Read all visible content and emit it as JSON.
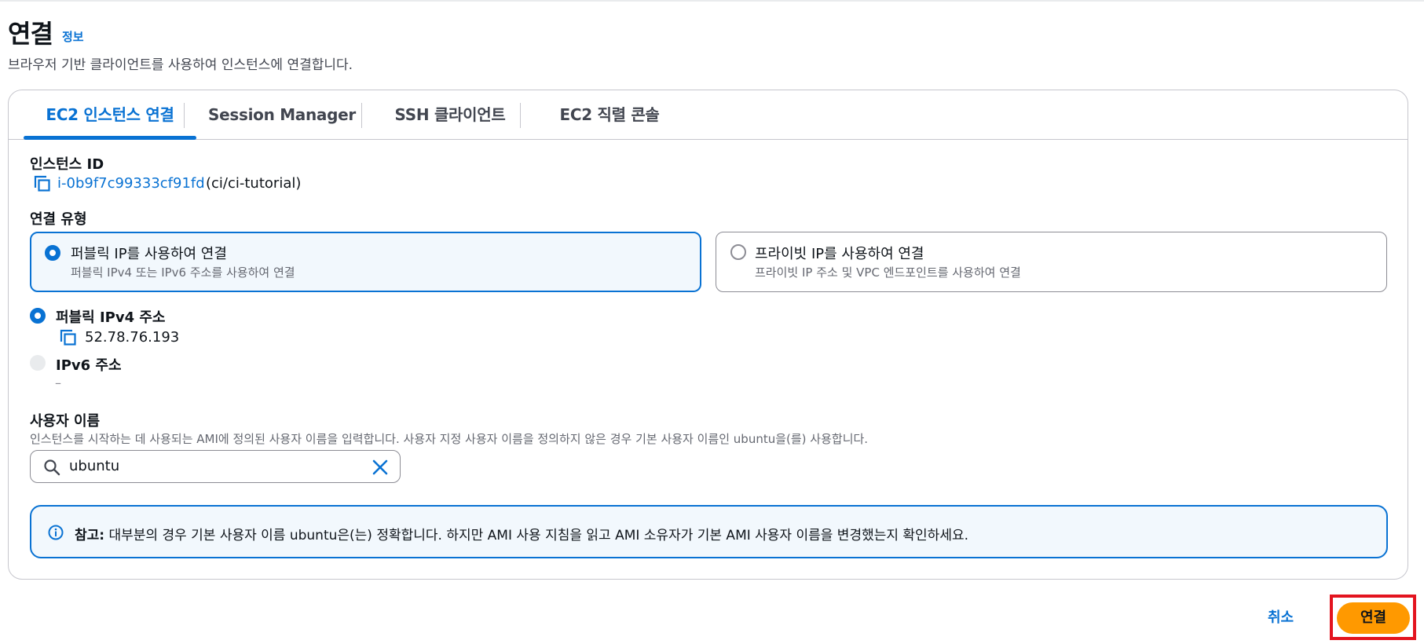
{
  "header": {
    "title": "연결",
    "info_link": "정보",
    "subtitle": "브라우저 기반 클라이언트를 사용하여 인스턴스에 연결합니다."
  },
  "tabs": [
    {
      "label": "EC2 인스턴스 연결",
      "active": true
    },
    {
      "label": "Session Manager",
      "active": false
    },
    {
      "label": "SSH 클라이언트",
      "active": false
    },
    {
      "label": "EC2 직렬 콘솔",
      "active": false
    }
  ],
  "instance": {
    "label": "인스턴스 ID",
    "id": "i-0b9f7c99333cf91fd",
    "name": "(ci/ci-tutorial)"
  },
  "connection_type": {
    "label": "연결 유형",
    "options": [
      {
        "title": "퍼블릭 IP를 사용하여 연결",
        "description": "퍼블릭 IPv4 또는 IPv6 주소를 사용하여 연결",
        "selected": true
      },
      {
        "title": "프라이빗 IP를 사용하여 연결",
        "description": "프라이빗 IP 주소 및 VPC 엔드포인트를 사용하여 연결",
        "selected": false
      }
    ]
  },
  "ip_options": {
    "ipv4": {
      "label": "퍼블릭 IPv4 주소",
      "value": "52.78.76.193",
      "selected": true
    },
    "ipv6": {
      "label": "IPv6 주소",
      "value": "–",
      "selected": false,
      "disabled": true
    }
  },
  "username": {
    "label": "사용자 이름",
    "description": "인스턴스를 시작하는 데 사용되는 AMI에 정의된 사용자 이름을 입력합니다. 사용자 지정 사용자 이름을 정의하지 않은 경우 기본 사용자 이름인 ubuntu을(를) 사용합니다.",
    "value": "ubuntu"
  },
  "alert": {
    "bold_label": "참고:",
    "text": " 대부분의 경우 기본 사용자 이름 ubuntu은(는) 정확합니다. 하지만 AMI 사용 지침을 읽고 AMI 소유자가 기본 AMI 사용자 이름을 변경했는지 확인하세요."
  },
  "footer": {
    "cancel_label": "취소",
    "connect_label": "연결"
  },
  "colors": {
    "accent": "#0972d3",
    "primary_button": "#ff9900",
    "highlight": "#e3141f"
  }
}
